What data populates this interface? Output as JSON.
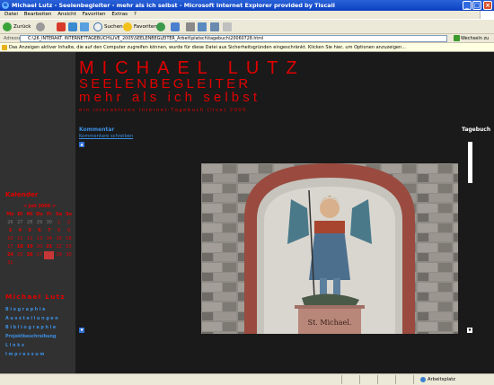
{
  "window": {
    "title": "Michael Lutz - Seelenbegleiter - mehr als ich selbst - Microsoft Internet Explorer provided by Tiscali",
    "minimize": "_",
    "maximize": "□",
    "close": "×"
  },
  "menu": [
    "Datei",
    "Bearbeiten",
    "Ansicht",
    "Favoriten",
    "Extras",
    "?"
  ],
  "toolbar": {
    "back_label": "Zurück",
    "search_label": "Suchen",
    "favorites_label": "Favoriten"
  },
  "address": {
    "label": "Adresse",
    "value": "C:\\26_INTERAKT. INTERNETTAGEBUCH\\LIVE_2005\\SEELENBEGLEITER_Arbeit\\platsch\\tagebuch\\20060728.html",
    "go_label": "Wechseln zu"
  },
  "infobar": {
    "text": "Das Anzeigen aktiver Inhalte, die auf den Computer zugreifen können, wurde für diese Datei aus Sicherheitsgründen eingeschränkt. Klicken Sie hier, um Optionen anzuzeigen..."
  },
  "header": {
    "line1": "MICHAEL LUTZ",
    "line2": "SEELENBEGLEITER",
    "line3": "mehr als ich selbst",
    "line4": "ein interaktives Internet-Tagebuch (live) 2006"
  },
  "content": {
    "kommentar": "Kommentar",
    "kommentar_link": "Kommentare schreiben",
    "tagebuch": "Tagebuch",
    "photo_caption": "St. Michael."
  },
  "calendar": {
    "title": "Kalender",
    "month": "< Juli 2006 >",
    "weekdays": [
      "Mo",
      "Di",
      "Mi",
      "Do",
      "Fr",
      "Sa",
      "So"
    ],
    "weeks": [
      [
        "26",
        "27",
        "28",
        "29",
        "30",
        "1",
        "2"
      ],
      [
        "3",
        "4",
        "5",
        "6",
        "7",
        "8",
        "9"
      ],
      [
        "10",
        "11",
        "12",
        "13",
        "14",
        "15",
        "16"
      ],
      [
        "17",
        "18",
        "19",
        "20",
        "21",
        "22",
        "23"
      ],
      [
        "24",
        "25",
        "26",
        "27",
        "28",
        "29",
        "30"
      ],
      [
        "31",
        "",
        "",
        "",
        "",
        "",
        ""
      ]
    ]
  },
  "nav": {
    "title": "Michael Lutz",
    "links": [
      "B i o g r a p h i e",
      "A u s s t e l l u n g e n",
      "B i b l i o g r a p h i e",
      "Projektbeschreibung",
      "L  i  n  k  s",
      "I m p r e s s u m"
    ]
  },
  "status": {
    "zone": "Arbeitsplatz"
  }
}
